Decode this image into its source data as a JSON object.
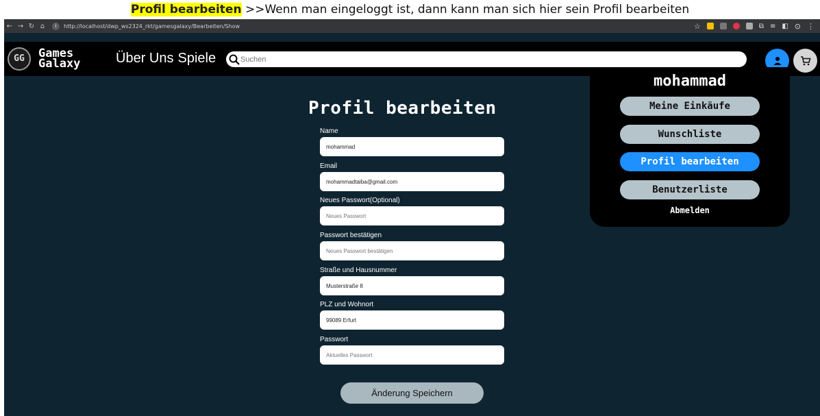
{
  "caption": {
    "highlight": "Profil bearbeiten",
    "text": " >>Wenn man eingeloggt ist, dann kann man sich hier sein Profil bearbeiten"
  },
  "browser": {
    "url": "http://localhost/dwp_ws2324_rkt/gamesgalaxy/Bearbeiten/Show"
  },
  "header": {
    "logo_badge": "GG",
    "logo_line1": "Games",
    "logo_line2": "Galaxy",
    "nav_about": "Über Uns",
    "nav_games": "Spiele",
    "search_placeholder": "Suchen"
  },
  "form": {
    "title": "Profil bearbeiten",
    "name_label": "Name",
    "name_value": "mohammad",
    "email_label": "Email",
    "email_value": "mohammadtaiba@gmail.com",
    "new_password_label": "Neues Passwort(Optional)",
    "new_password_placeholder": "Neues Passwort",
    "confirm_password_label": "Passwort bestätigen",
    "confirm_password_placeholder": "Neues Passwort bestätigen",
    "street_label": "Straße und Hausnummer",
    "street_value": "Musterstraße 8",
    "city_label": "PLZ und Wohnort",
    "city_value": "99089 Erfurt",
    "password_label": "Passwort",
    "password_placeholder": "Aktuelles Passwort",
    "save_label": "Änderung Speichern"
  },
  "menu": {
    "username": "mohammad",
    "purchases": "Meine Einkäufe",
    "wishlist": "Wunschliste",
    "edit_profile": "Profil bearbeiten",
    "user_list": "Benutzerliste",
    "logout": "Abmelden"
  },
  "colors": {
    "page_bg": "#0f2431",
    "accent": "#1e90ff",
    "menu_button": "#b5c4cb"
  }
}
